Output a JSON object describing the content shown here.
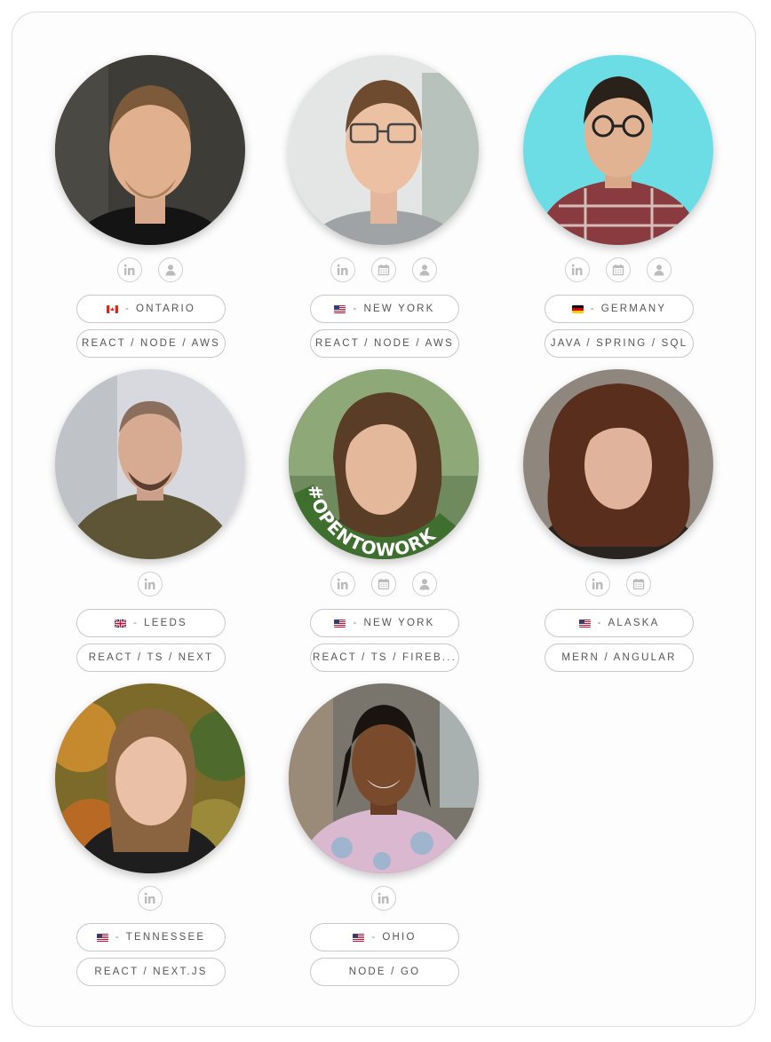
{
  "cards": [
    {
      "location": "ONTARIO",
      "flag": "canada",
      "stack": "REACT / NODE / AWS",
      "icons": [
        "linkedin-icon",
        "profile-icon"
      ],
      "bg": "#3b3a36"
    },
    {
      "location": "NEW YORK",
      "flag": "usa",
      "stack": "REACT / NODE / AWS",
      "icons": [
        "linkedin-icon",
        "calendar-icon",
        "profile-icon"
      ],
      "bg": "#d9dcdd"
    },
    {
      "location": "GERMANY",
      "flag": "germany",
      "stack": "JAVA / SPRING / SQL",
      "icons": [
        "linkedin-icon",
        "calendar-icon",
        "profile-icon"
      ],
      "bg": "#6fdce4"
    },
    {
      "location": "LEEDS",
      "flag": "uk",
      "stack": "REACT / TS / NEXT",
      "icons": [
        "linkedin-icon"
      ],
      "bg": "#c9ccd2"
    },
    {
      "location": "NEW YORK",
      "flag": "usa",
      "stack": "REACT / TS / FIREB...",
      "icons": [
        "linkedin-icon",
        "calendar-icon",
        "profile-icon"
      ],
      "bg": "#5b7d4e",
      "banner": "#OPENTOWORK"
    },
    {
      "location": "ALASKA",
      "flag": "usa",
      "stack": "MERN / ANGULAR",
      "icons": [
        "linkedin-icon",
        "calendar-icon"
      ],
      "bg": "#8a8178"
    },
    {
      "location": "TENNESSEE",
      "flag": "usa",
      "stack": "REACT / NEXT.JS",
      "icons": [
        "linkedin-icon"
      ],
      "bg": "#8d6a2c"
    },
    {
      "location": "OHIO",
      "flag": "usa",
      "stack": "NODE / GO",
      "icons": [
        "linkedin-icon"
      ],
      "bg": "#7f7a70"
    }
  ],
  "separator": "-"
}
